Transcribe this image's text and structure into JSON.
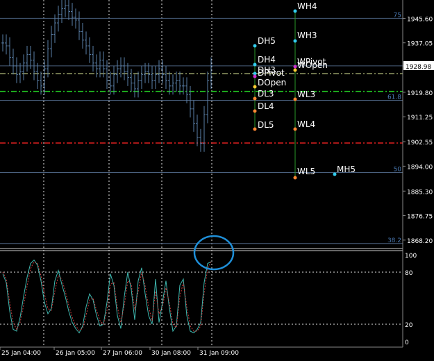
{
  "colors": {
    "background": "#000000",
    "grid": "#e6e6e6",
    "fib_line": "#4a607e",
    "candles": "#5a7fa8",
    "green_line": "#22cc22",
    "red_line": "#e02020",
    "olive_line": "#9aa36a",
    "stoch_main": "#3fb8b0",
    "stoch_signal": "#d04040",
    "circle": "#1f8fd8",
    "label_text": "#ffffff",
    "axis_text": "#ffffff",
    "fib_text": "#4a7ab5",
    "current_price_bg": "#ffffff",
    "current_price_text": "#000000"
  },
  "price_axis": {
    "ticks": [
      "1945.60",
      "1937.05",
      "1928.98",
      "1919.80",
      "1911.25",
      "1902.55",
      "1894.00",
      "1885.30",
      "1876.75",
      "1868.20"
    ],
    "current_price": "1928.98"
  },
  "time_axis": {
    "ticks": [
      "25 Jan 04:00",
      "26 Jan 05:00",
      "27 Jan 06:00",
      "30 Jan 08:00",
      "31 Jan 09:00"
    ]
  },
  "stoch_axis": {
    "ticks": [
      "100",
      "80",
      "20",
      "0"
    ]
  },
  "fib_levels": [
    {
      "label": "75",
      "price": 1945.6
    },
    {
      "label": "61.8",
      "price": 1917.0
    },
    {
      "label": "50",
      "price": 1891.8
    },
    {
      "label": "38.2",
      "price": 1867.0
    }
  ],
  "pivot_labels": {
    "daily": [
      "DH5",
      "DH4",
      "DH3",
      "DPivot",
      "DOpen",
      "DL3",
      "DL4",
      "DL5"
    ],
    "weekly": [
      "WH4",
      "WH3",
      "WPivot",
      "WOpen",
      "WL3",
      "WL4",
      "WL5"
    ],
    "monthly": [
      "MH5"
    ]
  },
  "chart_data": {
    "type": "line",
    "panels": [
      {
        "name": "price",
        "style": "bars",
        "ylim": [
          1865.5,
          1952.0
        ],
        "y_ticks": [
          1945.6,
          1937.05,
          1928.98,
          1919.8,
          1911.25,
          1902.55,
          1894.0,
          1885.3,
          1876.75,
          1868.2
        ],
        "x_ticks": [
          "25 Jan 04:00",
          "26 Jan 05:00",
          "27 Jan 06:00",
          "30 Jan 08:00",
          "31 Jan 09:00"
        ],
        "series": [
          {
            "values": [
              1937,
              1936,
              1932,
              1929,
              1926,
              1927,
              1930,
              1933,
              1931,
              1927,
              1924,
              1922,
              1928,
              1935,
              1940,
              1944,
              1947,
              1949,
              1950,
              1948,
              1946,
              1945,
              1941,
              1938,
              1936,
              1933,
              1930,
              1928,
              1931,
              1928,
              1924,
              1922,
              1926,
              1928,
              1929,
              1927,
              1925,
              1923,
              1921,
              1924,
              1926,
              1927,
              1926,
              1924,
              1926,
              1928,
              1926,
              1924,
              1922,
              1923,
              1924,
              1922,
              1922,
              1919,
              1914,
              1909,
              1904,
              1902,
              1912,
              1924,
              1929
            ]
          }
        ],
        "horizontal_lines": [
          {
            "price": 1926.3,
            "style": "dashdot",
            "color": "olive"
          },
          {
            "price": 1920.1,
            "style": "dashdot",
            "color": "green"
          },
          {
            "price": 1902.1,
            "style": "dashdot",
            "color": "red"
          },
          {
            "price": 1929.0,
            "style": "solid",
            "color": "fib"
          }
        ]
      },
      {
        "name": "stochastic",
        "ylim": [
          0,
          100
        ],
        "y_ticks": [
          100,
          80,
          20,
          0
        ],
        "series": [
          {
            "role": "main",
            "values": [
              78,
              68,
              35,
              14,
              12,
              28,
              52,
              74,
              90,
              94,
              88,
              70,
              45,
              32,
              38,
              70,
              82,
              66,
              52,
              35,
              22,
              15,
              10,
              18,
              40,
              55,
              48,
              30,
              18,
              20,
              45,
              78,
              65,
              30,
              15,
              52,
              80,
              60,
              25,
              70,
              85,
              55,
              30,
              20,
              72,
              22,
              45,
              70,
              38,
              12,
              18,
              65,
              72,
              30,
              12,
              10,
              14,
              22,
              68,
              90,
              92
            ]
          },
          {
            "role": "signal",
            "values": [
              80,
              72,
              45,
              22,
              14,
              22,
              42,
              64,
              84,
              92,
              90,
              76,
              55,
              38,
              36,
              58,
              76,
              72,
              58,
              42,
              28,
              18,
              13,
              15,
              30,
              48,
              50,
              36,
              24,
              20,
              36,
              66,
              68,
              40,
              22,
              42,
              70,
              66,
              36,
              58,
              80,
              64,
              40,
              24,
              58,
              32,
              40,
              62,
              44,
              20,
              16,
              52,
              68,
              40,
              18,
              12,
              12,
              18,
              56,
              84,
              92
            ]
          }
        ]
      }
    ]
  }
}
